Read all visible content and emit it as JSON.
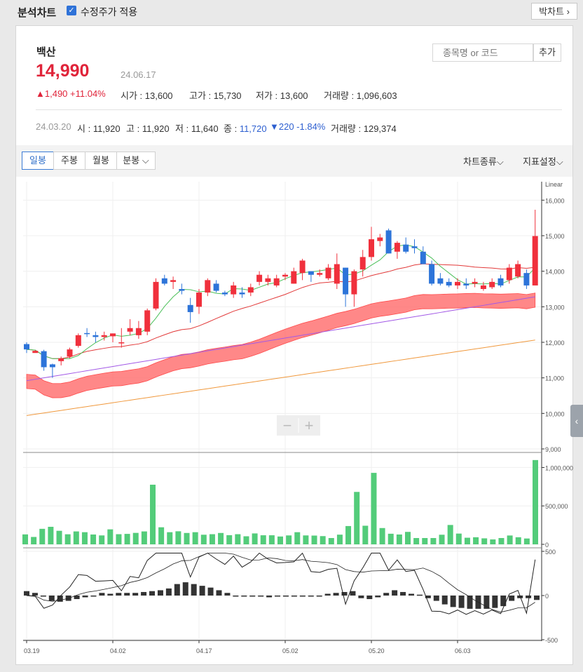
{
  "topbar": {
    "title": "분석차트",
    "adjusted_label": "수정주가 적용",
    "adjusted_checked": true,
    "bakchart_label": "박차트",
    "bakchart_icon": "chevron-right-icon"
  },
  "stock": {
    "name": "백산",
    "price": "14,990",
    "date": "24.06.17",
    "change": "▲1,490 +11.04%",
    "open_label": "시가",
    "open": "13,600",
    "high_label": "고가",
    "high": "15,730",
    "low_label": "저가",
    "low": "13,600",
    "vol_label": "거래량",
    "volume": "1,096,603"
  },
  "search": {
    "placeholder": "종목명 or 코드",
    "add_label": "추가"
  },
  "hover": {
    "date": "24.03.20",
    "o_label": "시",
    "o": "11,920",
    "h_label": "고",
    "h": "11,920",
    "l_label": "저",
    "l": "11,640",
    "c_label": "종",
    "c": "11,720",
    "chg": "▼220 -1.84%",
    "v_label": "거래량",
    "v": "129,374"
  },
  "tabs": {
    "daily": "일봉",
    "weekly": "주봉",
    "monthly": "월봉",
    "minute": "분봉"
  },
  "menus": {
    "chart_type": "차트종류",
    "indicators": "지표설정"
  },
  "zoom": {
    "minus": "−",
    "plus": "+"
  },
  "colors": {
    "up": "#f0303c",
    "down": "#2d74d9",
    "volume": "#53cc7a",
    "ma5": "#4cc05a",
    "ma20": "#e23a3a",
    "ma60": "#a259e6",
    "ma120": "#f0983c",
    "cloud": "#ff6a6a"
  },
  "chart_data": [
    {
      "type": "candlestick",
      "scale_label": "Linear",
      "ylim": [
        9000,
        16500
      ],
      "yticks": [
        "16,000",
        "15,000",
        "14,000",
        "13,000",
        "12,000",
        "11,000",
        "10,000",
        "9,000"
      ],
      "ytick_values": [
        16000,
        15000,
        14000,
        13000,
        12000,
        11000,
        10000,
        9000
      ],
      "xticks": [
        "03.19",
        "04.02",
        "04.17",
        "05.02",
        "05.20",
        "06.03"
      ],
      "xtick_index": [
        0,
        10,
        20,
        30,
        40,
        50
      ],
      "candles": [
        [
          11950,
          12000,
          11700,
          11800
        ],
        [
          11700,
          11780,
          11720,
          11760
        ],
        [
          11750,
          11790,
          11200,
          11300
        ],
        [
          11380,
          11400,
          11000,
          11300
        ],
        [
          11470,
          11600,
          11350,
          11550
        ],
        [
          11600,
          11850,
          11550,
          11800
        ],
        [
          11900,
          12250,
          11850,
          12200
        ],
        [
          12260,
          12400,
          12150,
          12250
        ],
        [
          12200,
          12300,
          12000,
          12150
        ],
        [
          12150,
          12300,
          12050,
          12200
        ],
        [
          12170,
          12250,
          12000,
          12250
        ],
        [
          12000,
          12400,
          11850,
          12000
        ],
        [
          12300,
          12650,
          12200,
          12400
        ],
        [
          12200,
          12600,
          12100,
          12400
        ],
        [
          12300,
          12950,
          12200,
          12900
        ],
        [
          12950,
          13800,
          12900,
          13700
        ],
        [
          13800,
          13900,
          13600,
          13650
        ],
        [
          13700,
          13850,
          13500,
          13750
        ],
        [
          13500,
          13650,
          13350,
          13450
        ],
        [
          13050,
          13250,
          12550,
          12850
        ],
        [
          13000,
          13500,
          12800,
          13400
        ],
        [
          13400,
          13800,
          13300,
          13750
        ],
        [
          13650,
          13750,
          13400,
          13450
        ],
        [
          13400,
          13450,
          13300,
          13350
        ],
        [
          13350,
          13700,
          13250,
          13600
        ],
        [
          13400,
          13550,
          13250,
          13350
        ],
        [
          13400,
          13650,
          13300,
          13550
        ],
        [
          13700,
          14000,
          13600,
          13900
        ],
        [
          13700,
          13900,
          13600,
          13800
        ],
        [
          13600,
          13900,
          13550,
          13800
        ],
        [
          13850,
          13950,
          13750,
          13900
        ],
        [
          13650,
          14100,
          13650,
          14000
        ],
        [
          13950,
          14350,
          13750,
          14300
        ],
        [
          14000,
          14000,
          13700,
          13900
        ],
        [
          13900,
          14050,
          13850,
          13950
        ],
        [
          13800,
          14200,
          13750,
          14100
        ],
        [
          13650,
          14500,
          13500,
          14200
        ],
        [
          14100,
          14100,
          13000,
          13350
        ],
        [
          13350,
          14050,
          13000,
          14000
        ],
        [
          14050,
          14600,
          13850,
          14400
        ],
        [
          14400,
          15250,
          14300,
          14900
        ],
        [
          14850,
          15050,
          14700,
          14950
        ],
        [
          15150,
          15200,
          14500,
          14500
        ],
        [
          14550,
          14850,
          14350,
          14800
        ],
        [
          14750,
          14950,
          14500,
          14550
        ],
        [
          14700,
          14900,
          14500,
          14650
        ],
        [
          14550,
          14700,
          14200,
          14200
        ],
        [
          14200,
          14300,
          13600,
          13650
        ],
        [
          13800,
          13950,
          13600,
          13650
        ],
        [
          13700,
          13800,
          13550,
          13600
        ],
        [
          13600,
          13800,
          13500,
          13700
        ],
        [
          13650,
          13800,
          13500,
          13600
        ],
        [
          13650,
          13800,
          13550,
          13700
        ],
        [
          13500,
          13700,
          13450,
          13600
        ],
        [
          13550,
          13800,
          13500,
          13700
        ],
        [
          13800,
          13900,
          13550,
          13600
        ],
        [
          13750,
          14200,
          13650,
          14100
        ],
        [
          13850,
          14300,
          13800,
          14200
        ],
        [
          13950,
          14050,
          13500,
          13600
        ],
        [
          13600,
          15730,
          13600,
          14990
        ]
      ],
      "volume": {
        "ylim": [
          0,
          1150000
        ],
        "yticks": [
          "1,000,000",
          "500,000",
          "0"
        ],
        "ytick_values": [
          1000000,
          500000,
          0
        ],
        "values": [
          129374,
          96000,
          202000,
          228000,
          176000,
          131000,
          168000,
          158000,
          128000,
          116000,
          195000,
          132000,
          136000,
          149000,
          168000,
          776000,
          222000,
          158000,
          170000,
          148000,
          158000,
          125000,
          132000,
          148000,
          119000,
          132000,
          105000,
          142000,
          118000,
          118000,
          102000,
          116000,
          158000,
          116000,
          114000,
          107000,
          82000,
          126000,
          238000,
          682000,
          242000,
          930000,
          212000,
          138000,
          128000,
          162000,
          82000,
          82000,
          82000,
          125000,
          252000,
          140000,
          86000,
          92000,
          78000,
          64000,
          82000,
          115000,
          92000,
          76000,
          1096603
        ]
      },
      "oscillator": {
        "ylim": [
          -500,
          500
        ],
        "yticks": [
          "500",
          "0",
          "-500"
        ],
        "ytick_values": [
          500,
          0,
          -500
        ],
        "histogram": [
          50,
          30,
          0,
          -60,
          -70,
          -60,
          -40,
          -20,
          0,
          30,
          20,
          30,
          30,
          30,
          40,
          50,
          60,
          80,
          130,
          150,
          130,
          110,
          90,
          60,
          30,
          0,
          -10,
          0,
          0,
          -20,
          0,
          0,
          0,
          0,
          0,
          0,
          20,
          30,
          40,
          50,
          -30,
          -40,
          -20,
          30,
          60,
          40,
          20,
          10,
          -30,
          -60,
          -100,
          -130,
          -140,
          -150,
          -150,
          -150,
          -140,
          -120,
          -60,
          -30,
          -30,
          -50
        ]
      }
    }
  ]
}
